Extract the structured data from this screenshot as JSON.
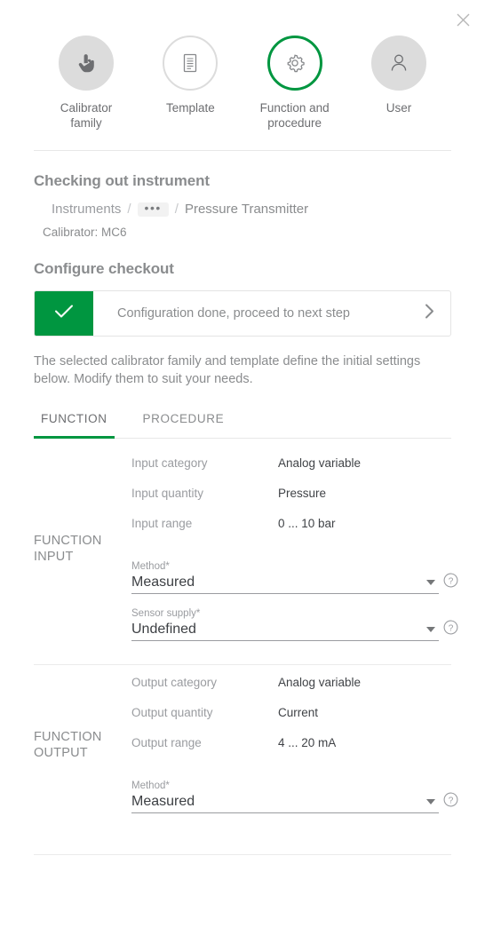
{
  "window": {
    "close_label": "close-icon"
  },
  "stepper": {
    "steps": [
      {
        "label": "Calibrator family",
        "icon": "hand-touch-icon",
        "state": "filled"
      },
      {
        "label": "Template",
        "icon": "document-icon",
        "state": "outline"
      },
      {
        "label": "Function and procedure",
        "icon": "gear-icon",
        "state": "active"
      },
      {
        "label": "User",
        "icon": "user-icon",
        "state": "filled"
      }
    ]
  },
  "header": {
    "title": "Checking out instrument",
    "breadcrumb": {
      "root": "Instruments",
      "more": "•••",
      "separator": "/",
      "current": "Pressure Transmitter"
    },
    "calibrator": "Calibrator: MC6"
  },
  "configure": {
    "title": "Configure checkout",
    "banner": {
      "check_icon": "checkmark-icon",
      "text": "Configuration done, proceed to next step",
      "arrow_icon": "chevron-right-icon"
    },
    "helper_text": "The selected calibrator family and template define the initial settings below. Modify them to suit your needs."
  },
  "tabs": [
    {
      "label": "FUNCTION",
      "active": true
    },
    {
      "label": "PROCEDURE",
      "active": false
    }
  ],
  "function_input": {
    "title": "FUNCTION INPUT",
    "rows": [
      {
        "key": "Input category",
        "value": "Analog variable"
      },
      {
        "key": "Input quantity",
        "value": "Pressure"
      },
      {
        "key": "Input range",
        "value": "0 ... 10 bar"
      }
    ],
    "fields": [
      {
        "label": "Method",
        "required": "*",
        "value": "Measured"
      },
      {
        "label": "Sensor supply",
        "required": "*",
        "value": "Undefined"
      }
    ]
  },
  "function_output": {
    "title": "FUNCTION OUTPUT",
    "rows": [
      {
        "key": "Output category",
        "value": "Analog variable"
      },
      {
        "key": "Output quantity",
        "value": "Current"
      },
      {
        "key": "Output range",
        "value": "4 ... 20 mA"
      }
    ],
    "fields": [
      {
        "label": "Method",
        "required": "*",
        "value": "Measured"
      }
    ]
  },
  "colors": {
    "accent_green": "#009640",
    "text_muted": "#8a8c8e",
    "text_value": "#404347",
    "circle_gray": "#dcdcdc"
  }
}
